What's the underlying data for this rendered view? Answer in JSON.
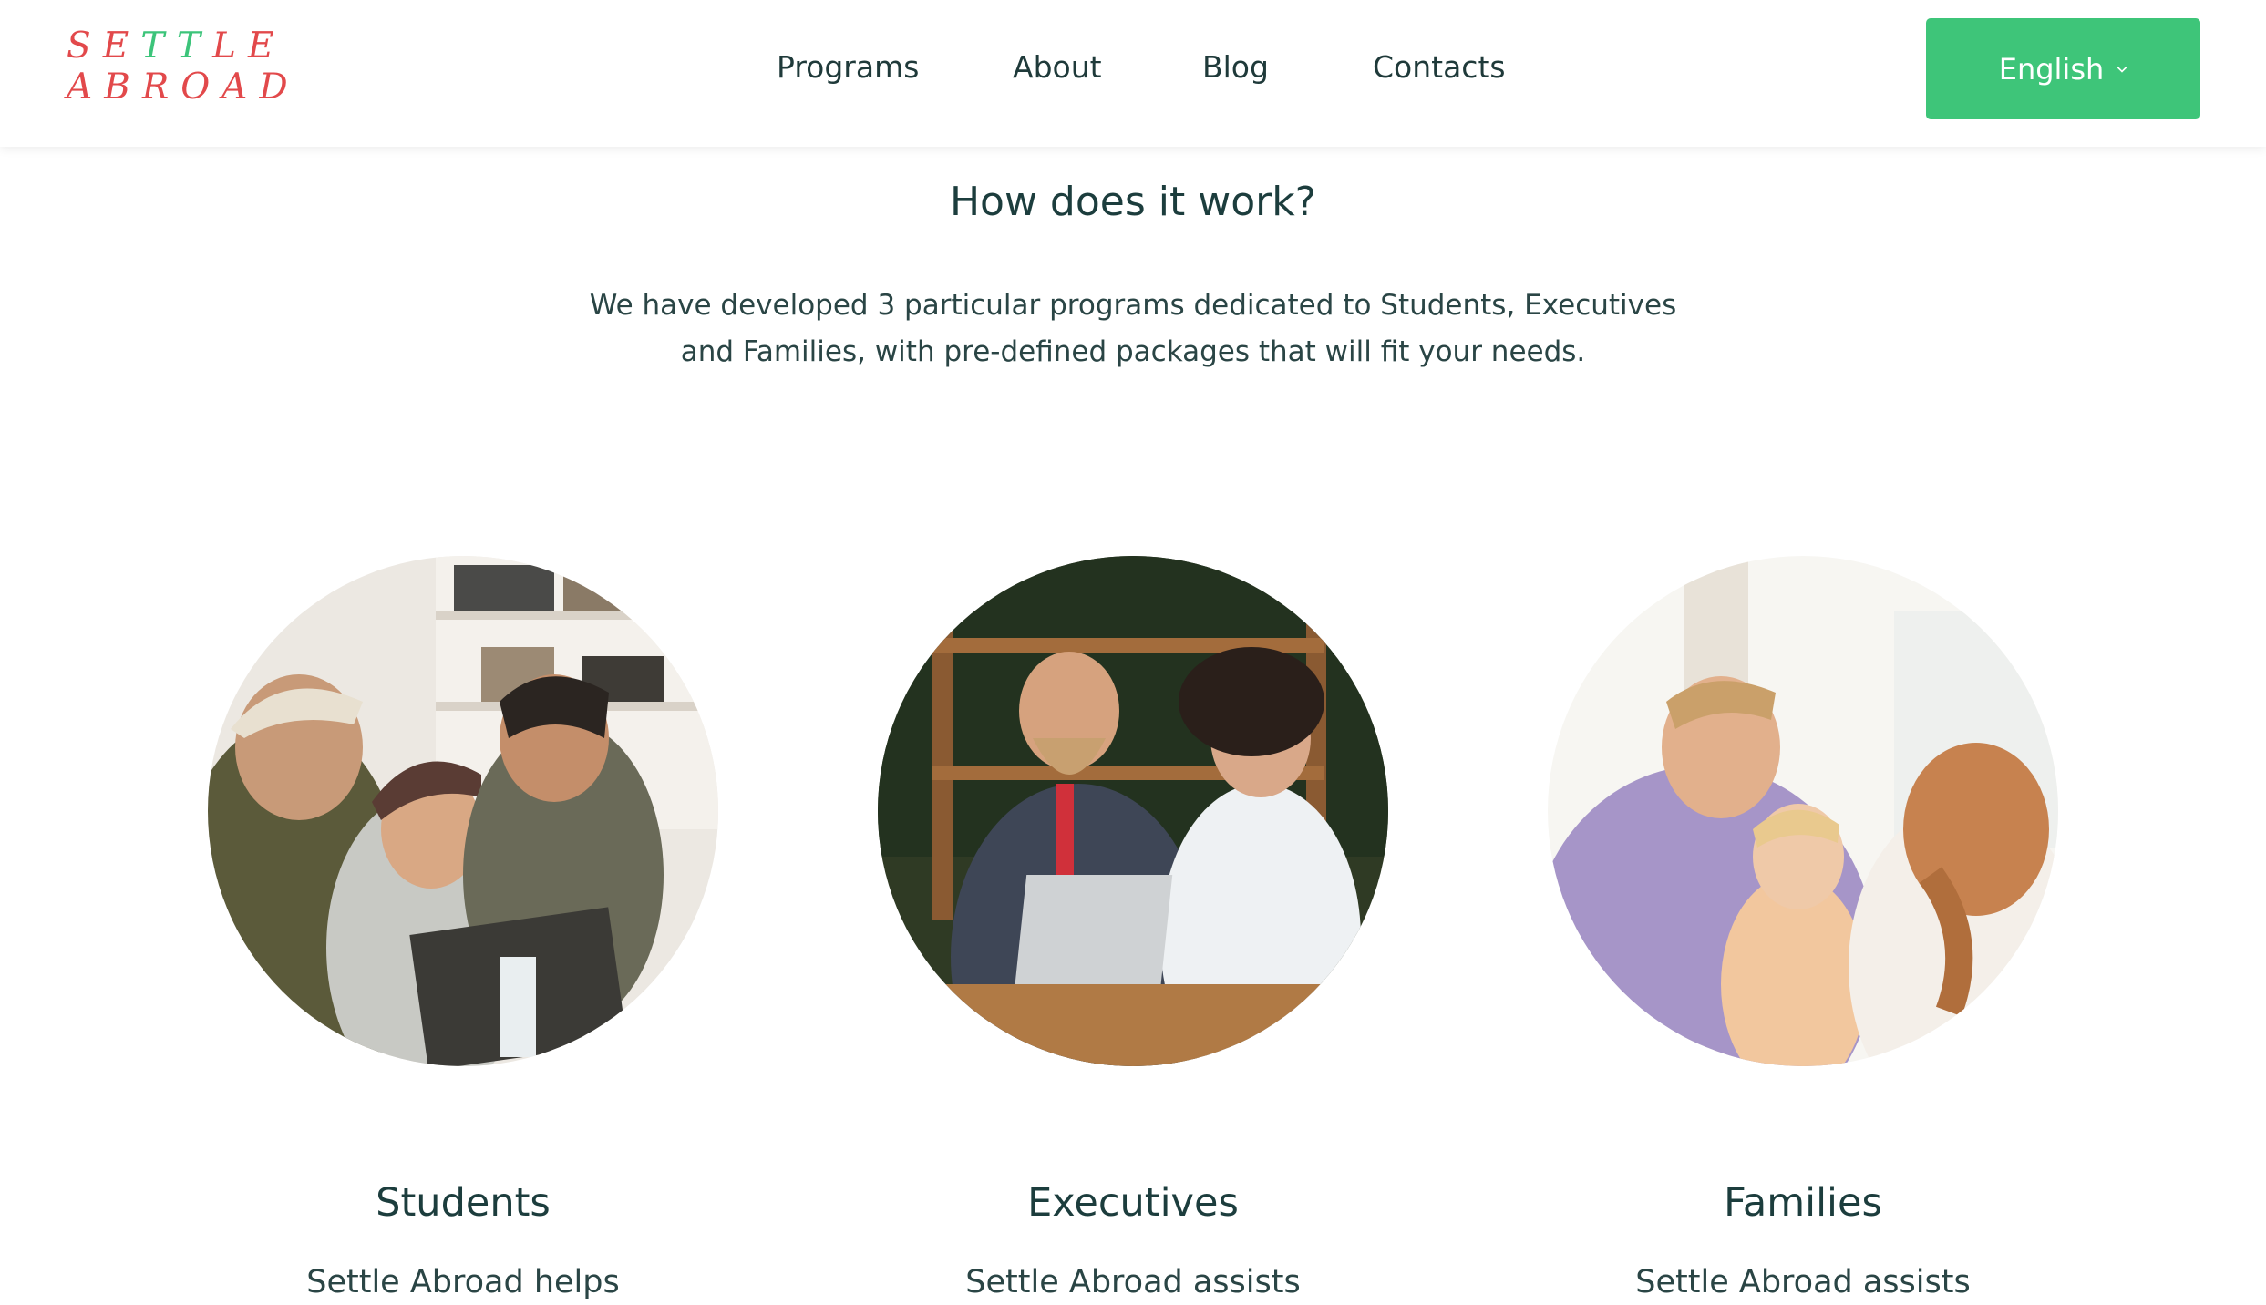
{
  "logo": {
    "line1_a": "SE",
    "line1_accent": "TT",
    "line1_b": "LE",
    "line2": "ABROAD"
  },
  "nav": {
    "items": [
      "Programs",
      "About",
      "Blog",
      "Contacts"
    ]
  },
  "language": {
    "selected": "English",
    "icon": "chevron-down-icon"
  },
  "colors": {
    "brand_green": "#3ec579",
    "brand_red": "#e2494b",
    "text": "#1f3a3a"
  },
  "section": {
    "title": "How does it work?",
    "intro": "We have developed 3 particular programs dedicated to Students, Executives and Families, with pre-defined packages that will fit your needs."
  },
  "programs": [
    {
      "title": "Students",
      "description": "Settle Abroad helps"
    },
    {
      "title": "Executives",
      "description": "Settle Abroad assists"
    },
    {
      "title": "Families",
      "description": "Settle Abroad assists"
    }
  ]
}
